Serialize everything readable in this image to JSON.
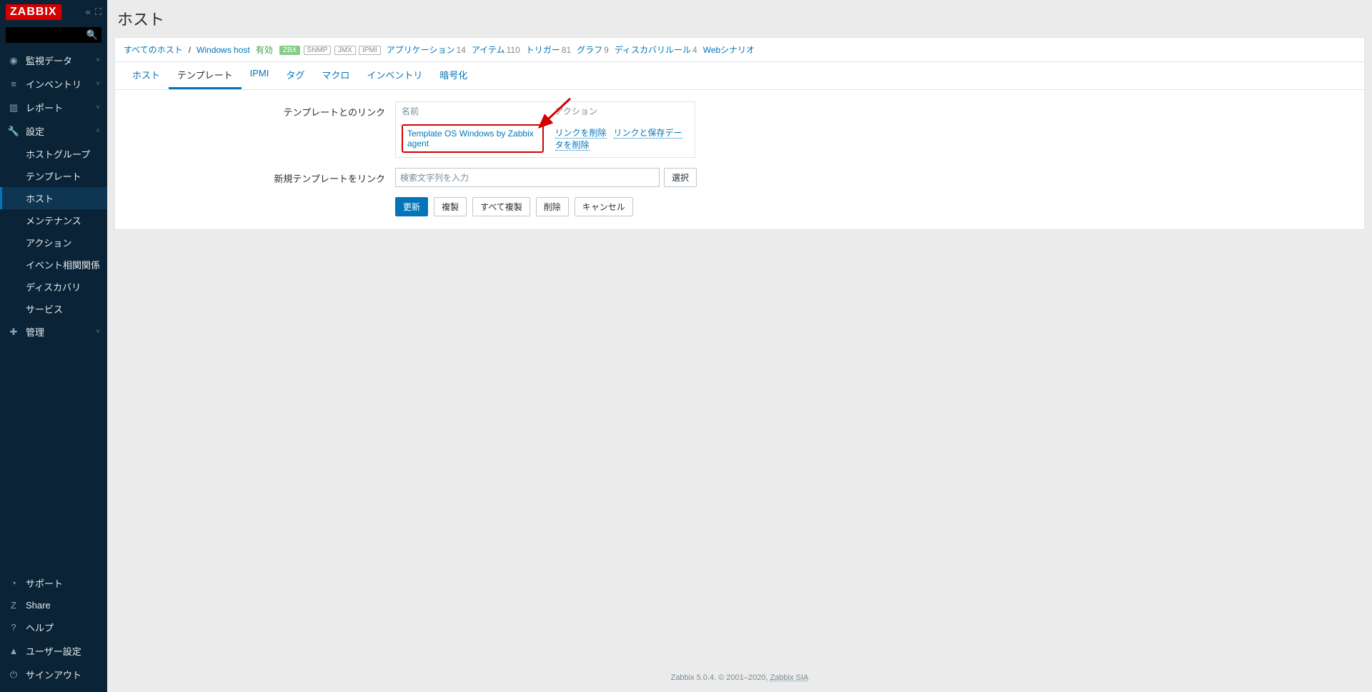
{
  "sidebar": {
    "logo": "ZABBIX",
    "search_placeholder": "",
    "nav": [
      {
        "icon": "eye",
        "label": "監視データ",
        "expanded": false
      },
      {
        "icon": "list",
        "label": "インベントリ",
        "expanded": false
      },
      {
        "icon": "chart",
        "label": "レポート",
        "expanded": false
      },
      {
        "icon": "wrench",
        "label": "設定",
        "expanded": true,
        "children": [
          {
            "label": "ホストグループ"
          },
          {
            "label": "テンプレート"
          },
          {
            "label": "ホスト",
            "active": true
          },
          {
            "label": "メンテナンス"
          },
          {
            "label": "アクション"
          },
          {
            "label": "イベント相関関係"
          },
          {
            "label": "ディスカバリ"
          },
          {
            "label": "サービス"
          }
        ]
      },
      {
        "icon": "gear",
        "label": "管理",
        "expanded": false
      }
    ],
    "footer": [
      {
        "icon": "headset",
        "label": "サポート"
      },
      {
        "icon": "z",
        "label": "Share"
      },
      {
        "icon": "question",
        "label": "ヘルプ"
      },
      {
        "icon": "user",
        "label": "ユーザー設定"
      },
      {
        "icon": "power",
        "label": "サインアウト"
      }
    ]
  },
  "page": {
    "title": "ホスト"
  },
  "breadcrumb": {
    "all_hosts": "すべてのホスト",
    "host_name": "Windows host",
    "status": "有効",
    "badges": {
      "zbx": "ZBX",
      "snmp": "SNMP",
      "jmx": "JMX",
      "ipmi": "IPMI"
    },
    "links": [
      {
        "label": "アプリケーション",
        "count": "14"
      },
      {
        "label": "アイテム",
        "count": "110"
      },
      {
        "label": "トリガー",
        "count": "81"
      },
      {
        "label": "グラフ",
        "count": "9"
      },
      {
        "label": "ディスカバリルール",
        "count": "4"
      },
      {
        "label": "Webシナリオ",
        "count": ""
      }
    ]
  },
  "tabs": [
    {
      "label": "ホスト"
    },
    {
      "label": "テンプレート",
      "active": true
    },
    {
      "label": "IPMI"
    },
    {
      "label": "タグ"
    },
    {
      "label": "マクロ"
    },
    {
      "label": "インベントリ"
    },
    {
      "label": "暗号化"
    }
  ],
  "form": {
    "linked_label": "テンプレートとのリンク",
    "th_name": "名前",
    "th_action": "アクション",
    "template_name": "Template OS Windows by Zabbix agent",
    "unlink": "リンクを削除",
    "unlink_clear": "リンクと保存データを削除",
    "newlink_label": "新規テンプレートをリンク",
    "newlink_placeholder": "検索文字列を入力",
    "select_btn": "選択",
    "buttons": {
      "update": "更新",
      "clone": "複製",
      "fullclone": "すべて複製",
      "delete": "削除",
      "cancel": "キャンセル"
    }
  },
  "footer": {
    "text": "Zabbix 5.0.4. © 2001–2020, ",
    "link": "Zabbix SIA"
  },
  "icons": {
    "eye": "◉",
    "list": "≡",
    "chart": "▥",
    "wrench": "🔧",
    "gear": "✚",
    "headset": "◔",
    "z": "Z",
    "question": "?",
    "user": "▲",
    "power": "⏻",
    "chev_collapsed": "˅",
    "chev_expanded": "˄",
    "collapse": "«",
    "fullscreen": "⛶",
    "search": "🔍"
  }
}
